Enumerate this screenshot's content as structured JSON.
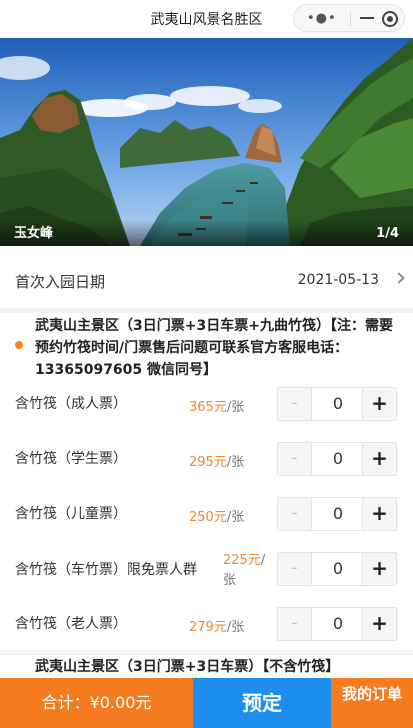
{
  "navbar": {
    "title": "武夷山风景名胜区",
    "more_icon": "more-dots-icon",
    "minimize_icon": "minimize-icon",
    "close_icon": "target-circle-icon"
  },
  "banner": {
    "caption": "玉女峰",
    "pager": "1/4"
  },
  "visit_date": {
    "label": "首次入园日期",
    "value": "2021-05-13"
  },
  "sections": [
    {
      "title": "武夷山主景区（3日门票+3日车票+九曲竹筏）【注：需要预约竹筏时间/门票售后问题可联系官方客服电话：13365097605 微信同号】",
      "tickets": [
        {
          "name": "含竹筏（成人票）",
          "price": "365元",
          "unit": "/张",
          "qty": "0"
        },
        {
          "name": "含竹筏（学生票）",
          "price": "295元",
          "unit": "/张",
          "qty": "0"
        },
        {
          "name": "含竹筏（儿童票）",
          "price": "250元",
          "unit": "/张",
          "qty": "0"
        },
        {
          "name": "含竹筏（车竹票）限免票人群",
          "price": "225元",
          "unit": "/张",
          "qty": "0"
        },
        {
          "name": "含竹筏（老人票）",
          "price": "279元",
          "unit": "/张",
          "qty": "0"
        }
      ]
    },
    {
      "title": "武夷山主景区（3日门票+3日车票）【不含竹筏】"
    }
  ],
  "stepper": {
    "minus": "-",
    "plus": "+"
  },
  "footer": {
    "total": "合计：¥0.00元",
    "book": "预定",
    "orders": "我的订单"
  },
  "colors": {
    "accent_orange": "#f47b20",
    "price_orange": "#f0862c",
    "book_blue": "#1c8ef0"
  }
}
